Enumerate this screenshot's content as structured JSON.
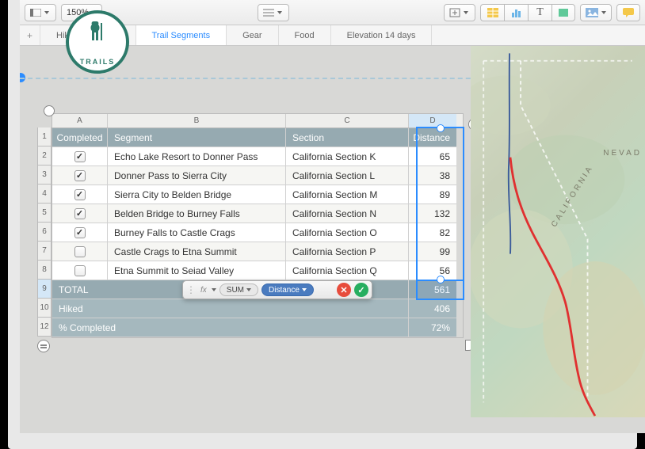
{
  "toolbar": {
    "zoom_level": "150%"
  },
  "tabs": [
    {
      "label": "Hiking Schedule",
      "active": false
    },
    {
      "label": "Trail Segments",
      "active": true
    },
    {
      "label": "Gear",
      "active": false
    },
    {
      "label": "Food",
      "active": false
    },
    {
      "label": "Elevation 14 days",
      "active": false
    }
  ],
  "logo": {
    "text": "TRAILS"
  },
  "sheet": {
    "columns": [
      "A",
      "B",
      "C",
      "D"
    ],
    "headers": {
      "completed": "Completed",
      "segment": "Segment",
      "section": "Section",
      "distance": "Distance"
    },
    "row_nums": [
      "1",
      "2",
      "3",
      "4",
      "5",
      "6",
      "7",
      "8",
      "9",
      "10",
      "12"
    ],
    "rows": [
      {
        "completed": true,
        "segment": "Echo Lake Resort to Donner Pass",
        "section": "California Section K",
        "distance": "65"
      },
      {
        "completed": true,
        "segment": "Donner Pass to Sierra City",
        "section": "California Section L",
        "distance": "38"
      },
      {
        "completed": true,
        "segment": "Sierra City to Belden Bridge",
        "section": "California Section M",
        "distance": "89"
      },
      {
        "completed": true,
        "segment": "Belden Bridge to Burney Falls",
        "section": "California Section N",
        "distance": "132"
      },
      {
        "completed": true,
        "segment": "Burney Falls to Castle Crags",
        "section": "California Section O",
        "distance": "82"
      },
      {
        "completed": false,
        "segment": "Castle Crags to Etna Summit",
        "section": "California Section P",
        "distance": "99"
      },
      {
        "completed": false,
        "segment": "Etna Summit to Seiad Valley",
        "section": "California Section Q",
        "distance": "56"
      }
    ],
    "total_label": "TOTAL",
    "total_value": "561",
    "hiked_label": "Hiked",
    "hiked_value": "406",
    "pct_label": "% Completed",
    "pct_value": "72%"
  },
  "formula": {
    "fx": "fx",
    "func": "SUM",
    "arg": "Distance"
  },
  "map": {
    "state1": "CALIFORNIA",
    "state2": "NEVAD"
  }
}
